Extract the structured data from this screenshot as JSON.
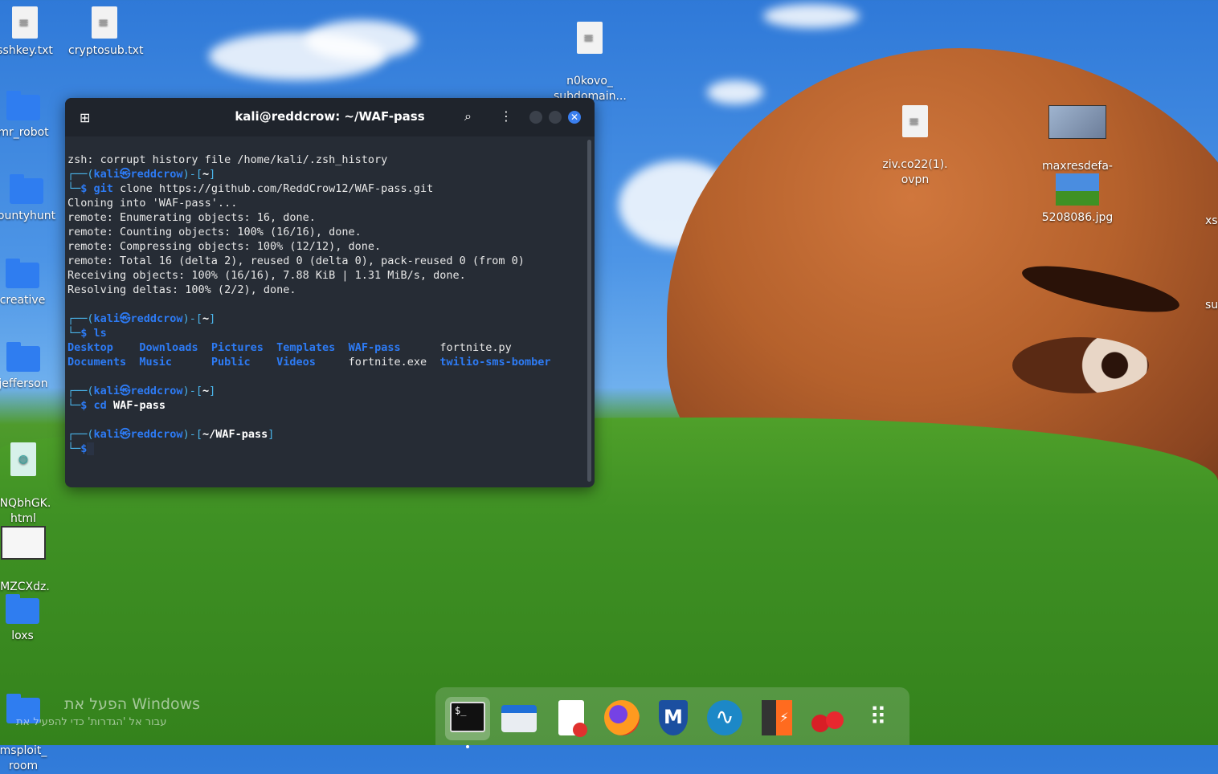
{
  "desktop_icons": [
    {
      "label": "sshkey.txt",
      "type": "file"
    },
    {
      "label": "cryptosub.txt",
      "type": "file"
    },
    {
      "label": "n0kovo_\nsubdomain...",
      "type": "file"
    },
    {
      "label": "mr_robot",
      "type": "folder"
    },
    {
      "label": "ountyhunt",
      "type": "folder"
    },
    {
      "label": "creative",
      "type": "folder"
    },
    {
      "label": "jefferson",
      "type": "folder"
    },
    {
      "label": "fNQbhGK.\nhtml",
      "type": "html"
    },
    {
      "label": "lMZCXdz.\njpeg",
      "type": "image"
    },
    {
      "label": "loxs",
      "type": "folder"
    },
    {
      "label": "msploit_\nroom",
      "type": "folder"
    },
    {
      "label": "ziv.co22(1).\novpn",
      "type": "file"
    },
    {
      "label": "maxresdefa-\nult.jpg",
      "type": "image"
    },
    {
      "label": "5208086.jpg",
      "type": "image"
    },
    {
      "label": "xs",
      "type": "partial"
    },
    {
      "label": "su",
      "type": "partial"
    }
  ],
  "terminal": {
    "title": "kali@reddcrow: ~/WAF-pass",
    "lines": {
      "l1": "zsh: corrupt history file /home/kali/.zsh_history",
      "p_user": "kali",
      "p_at": "㉿",
      "p_host": "reddcrow",
      "p_home": "~",
      "p_waf": "~/WAF-pass",
      "cmd1_git": "git",
      "cmd1_rest": " clone https://github.com/ReddCrow12/WAF-pass.git",
      "out1": "Cloning into 'WAF-pass'...",
      "out2": "remote: Enumerating objects: 16, done.",
      "out3": "remote: Counting objects: 100% (16/16), done.",
      "out4": "remote: Compressing objects: 100% (12/12), done.",
      "out5": "remote: Total 16 (delta 2), reused 0 (delta 0), pack-reused 0 (from 0)",
      "out6": "Receiving objects: 100% (16/16), 7.88 KiB | 1.31 MiB/s, done.",
      "out7": "Resolving deltas: 100% (2/2), done.",
      "cmd2": "ls",
      "ls_desktop": "Desktop",
      "ls_downloads": "Downloads",
      "ls_pictures": "Pictures",
      "ls_templates": "Templates",
      "ls_wafpass": "WAF-pass",
      "ls_fortnitepy": "fortnite.py",
      "ls_documents": "Documents",
      "ls_music": "Music",
      "ls_public": "Public",
      "ls_videos": "Videos",
      "ls_fortniteexe": "fortnite.exe",
      "ls_twilio": "twilio-sms-bomber",
      "cmd3_cd": "cd",
      "cmd3_arg": "WAF-pass",
      "dollar": "$"
    }
  },
  "activation_watermark": {
    "line1": "הפעל את Windows",
    "line2": "עבור אל 'הגדרות' כדי להפעיל את"
  },
  "dock": [
    "terminal",
    "files",
    "text-editor",
    "firefox",
    "metasploit",
    "wireshark",
    "burp",
    "cherrytree",
    "app-grid"
  ]
}
